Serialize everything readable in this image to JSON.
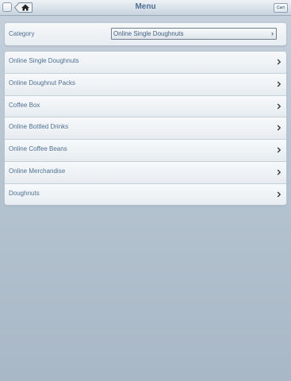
{
  "header": {
    "title": "Menu",
    "cart_label": "Cart"
  },
  "category": {
    "label": "Category",
    "selected": "Online Single Doughnuts"
  },
  "menu_items": [
    {
      "label": "Online Single Doughnuts"
    },
    {
      "label": "Online Doughnut Packs"
    },
    {
      "label": "Coffee Box"
    },
    {
      "label": "Online Bottled Drinks"
    },
    {
      "label": "Online Coffee Beans"
    },
    {
      "label": "Online Merchandise"
    },
    {
      "label": "Doughnuts"
    }
  ],
  "icons": {
    "home": "home-icon",
    "back": "back-icon",
    "chevron": "chevron-right-icon"
  },
  "colors": {
    "accent_text": "#4f6f93",
    "background": "#b8c6d3"
  }
}
